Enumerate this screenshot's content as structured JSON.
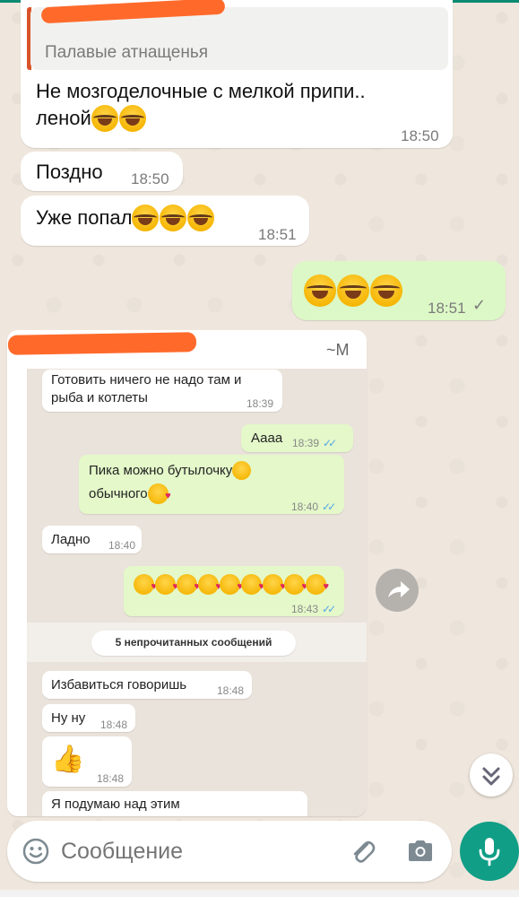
{
  "chat": {
    "quoted_title": "Палавые атнащенья",
    "msg1_line1": "Не мозгоделочные с мелкой припи..",
    "msg1_line2": "леной",
    "msg1_time": "18:50",
    "msg2_text": "Поздно",
    "msg2_time": "18:50",
    "msg3_text": "Уже попал",
    "msg3_time": "18:51",
    "msg4_time": "18:51",
    "forward_sender_initial": "~M"
  },
  "screenshot": {
    "m1_line1": "Готовить ничего не надо там и",
    "m1_line2": "рыба и котлеты",
    "m1_time": "18:39",
    "m2_text": "Аааа",
    "m2_time": "18:39",
    "m3_line1": "Пика можно бутылочку",
    "m3_line2": "обычного",
    "m3_time": "18:40",
    "m4_text": "Ладно",
    "m4_time": "18:40",
    "m5_time": "18:43",
    "unread": "5 непрочитанных сообщений",
    "m6_text": "Избавиться говоришь",
    "m6_time": "18:48",
    "m7_text": "Ну ну",
    "m7_time": "18:48",
    "m8_time": "18:48",
    "m9_text": "Я подумаю над этим"
  },
  "composer": {
    "placeholder": "Сообщение"
  },
  "icons": {
    "emoji": "smiley-icon",
    "attach": "paperclip-icon",
    "camera": "camera-icon",
    "mic": "microphone-icon",
    "forward": "forward-arrow-icon",
    "scroll": "double-chevron-down-icon"
  },
  "colors": {
    "accent": "#109e86",
    "outgoing_bubble": "#dcf8c6",
    "read_ticks": "#53a6e6"
  }
}
